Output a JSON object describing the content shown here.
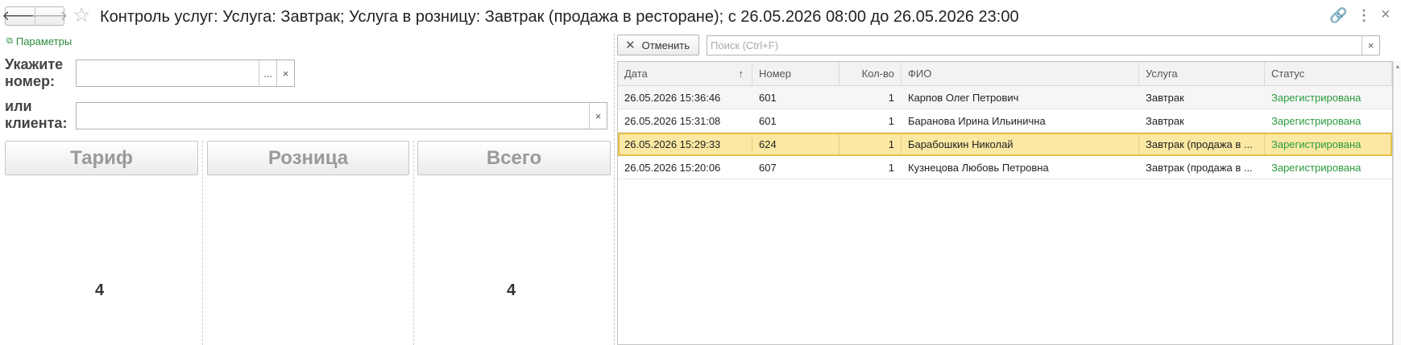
{
  "window": {
    "title": "Контроль услуг: Услуга: Завтрак; Услуга в розницу: Завтрак (продажа в ресторане); с 26.05.2026 08:00 до 26.05.2026 23:00",
    "back_glyph": "🡐",
    "forward_glyph": "🡒",
    "star_glyph": "☆",
    "link_glyph": "🔗",
    "more_glyph": "⋮",
    "close_glyph": "×"
  },
  "left": {
    "params_label": "Параметры",
    "params_icon": "⧉",
    "number_label": "Укажите номер:",
    "number_value": "",
    "client_label": "или клиента:",
    "client_value": "",
    "select_glyph": "...",
    "clear_glyph": "×",
    "buttons": {
      "tarif": "Тариф",
      "roznitsa": "Розница",
      "vsego": "Всего"
    },
    "counts": {
      "tarif": "4",
      "vsego": "4"
    }
  },
  "right": {
    "cancel_label": "Отменить",
    "cancel_glyph": "✕",
    "search_placeholder": "Поиск (Ctrl+F)",
    "search_value": "",
    "clear_glyph": "×",
    "columns": {
      "date": "Дата",
      "sort_glyph": "↑",
      "number": "Номер",
      "qty": "Кол-во",
      "fio": "ФИО",
      "service": "Услуга",
      "status": "Статус"
    },
    "rows": [
      {
        "date": "26.05.2026 15:36:46",
        "number": "601",
        "qty": "1",
        "fio": "Карпов Олег Петрович",
        "service": "Завтрак",
        "status": "Зарегистрирована"
      },
      {
        "date": "26.05.2026 15:31:08",
        "number": "601",
        "qty": "1",
        "fio": "Баранова Ирина Ильинична",
        "service": "Завтрак",
        "status": "Зарегистрирована"
      },
      {
        "date": "26.05.2026 15:29:33",
        "number": "624",
        "qty": "1",
        "fio": "Барабошкин Николай",
        "service": "Завтрак (продажа в ...",
        "status": "Зарегистрирована"
      },
      {
        "date": "26.05.2026 15:20:06",
        "number": "607",
        "qty": "1",
        "fio": "Кузнецова Любовь Петровна",
        "service": "Завтрак (продажа в ...",
        "status": "Зарегистрирована"
      }
    ],
    "selected_row_index": 2
  },
  "colors": {
    "accent_green": "#2a9a3c",
    "selection": "#fbe8a2",
    "selection_border": "#e3c04a"
  }
}
